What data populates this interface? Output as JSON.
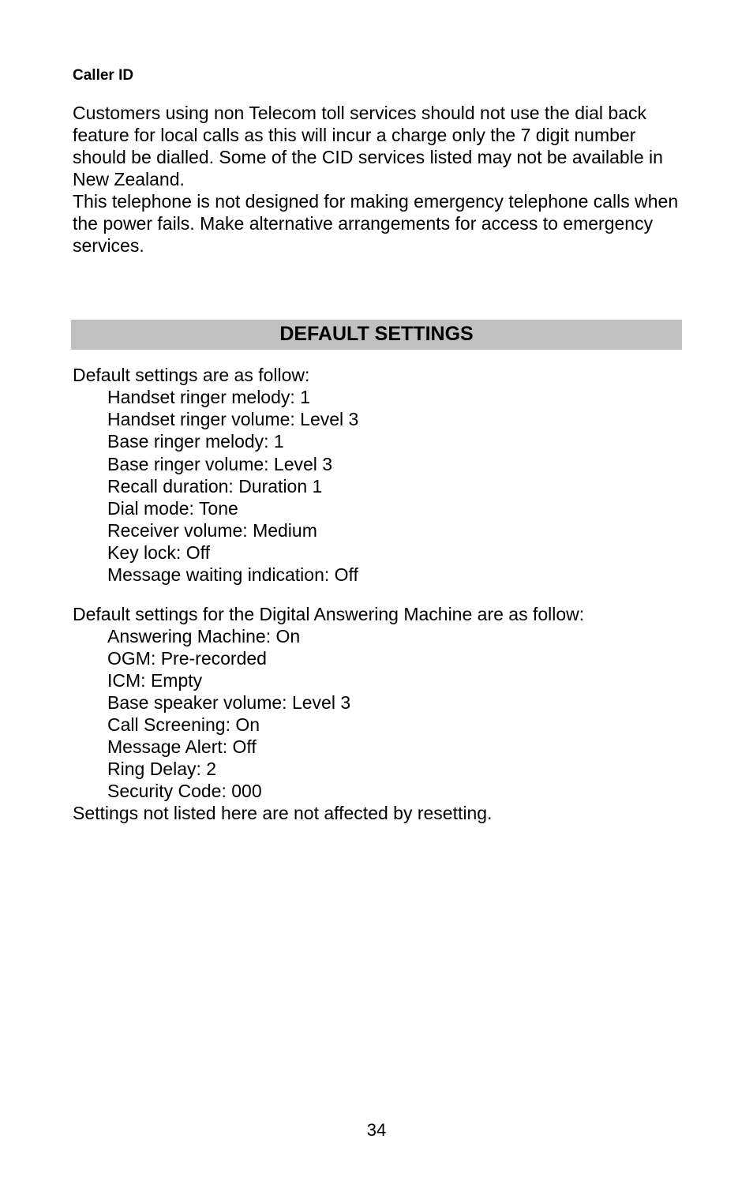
{
  "callerId": {
    "heading": "Caller ID",
    "para1": "Customers using non Telecom toll services should not use the dial back feature for local calls as this will incur a charge only the 7 digit number should be dialled. Some of the CID services listed may not be available in New Zealand.",
    "para2": "This telephone is not designed for making emergency telephone calls when the power fails.  Make alternative arrangements for access to emergency services."
  },
  "defaultSettings": {
    "title": "DEFAULT SETTINGS",
    "intro1": "Default settings are as follow:",
    "handset": {
      "ringerMelody": "Handset ringer melody:  1",
      "ringerVolume": "Handset ringer volume:  Level 3",
      "baseRingerMelody": "Base ringer melody:  1",
      "baseRingerVolume": "Base ringer volume:  Level 3",
      "recallDuration": "Recall duration:  Duration 1",
      "dialMode": "Dial mode:  Tone",
      "receiverVolume": "Receiver volume:  Medium",
      "keyLock": "Key lock:  Off",
      "messageWaiting": "Message waiting indication:  Off"
    },
    "intro2": "Default settings for the Digital Answering Machine are as follow:",
    "answering": {
      "answeringMachine": "Answering Machine:  On",
      "ogm": "OGM:  Pre-recorded",
      "icm": "ICM:  Empty",
      "baseSpeakerVolume": "Base speaker volume:  Level 3",
      "callScreening": "Call Screening:  On",
      "messageAlert": "Message Alert:  Off",
      "ringDelay": "Ring Delay:  2",
      "securityCode": "Security Code:  000"
    },
    "footer": "Settings not listed here are not affected by resetting."
  },
  "pageNumber": "34"
}
